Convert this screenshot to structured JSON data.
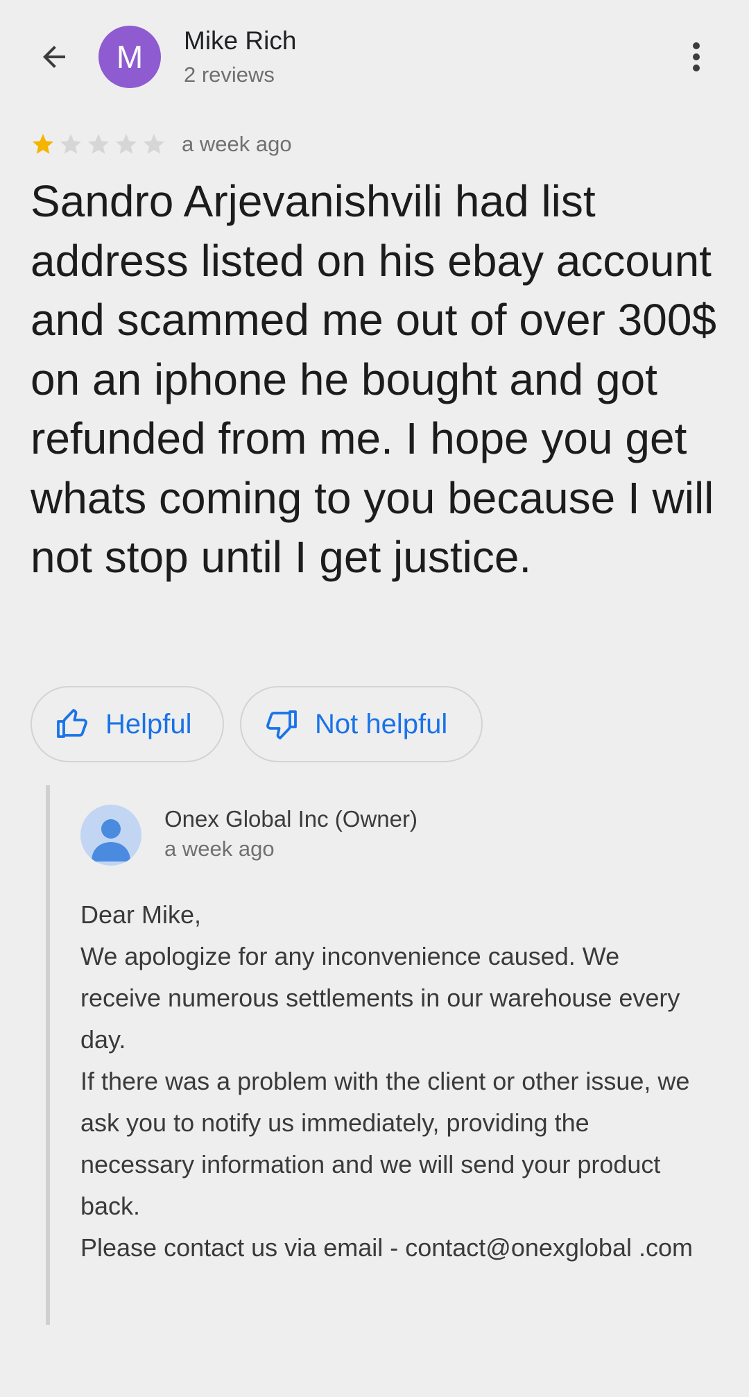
{
  "header": {
    "avatar_letter": "M",
    "avatar_color": "#8e5bd1",
    "name": "Mike Rich",
    "review_count": "2 reviews",
    "back_icon": "arrow-back-icon",
    "menu_icon": "more-vert-icon"
  },
  "rating": {
    "stars": 1,
    "max_stars": 5,
    "star_color": "#f4b400",
    "time": "a week ago"
  },
  "review": {
    "text": "Sandro Arjevanishvili had list address listed on his ebay account and scammed me out of over 300$ on an iphone he bought and got refunded from me. I hope you get whats coming to you because I will not stop until I get justice."
  },
  "actions": {
    "helpful_label": "Helpful",
    "not_helpful_label": "Not helpful",
    "accent_color": "#1a73e8"
  },
  "owner_reply": {
    "name": "Onex Global Inc (Owner)",
    "time": "a week ago",
    "lines": [
      "Dear Mike,",
      "We apologize for any inconvenience caused. We receive numerous settlements in our warehouse every day.",
      "If there was a problem with the client or other issue, we ask you to notify us immediately, providing the necessary information and we will send your product back.",
      "Please contact us via email - contact@onexglobal .com"
    ]
  }
}
